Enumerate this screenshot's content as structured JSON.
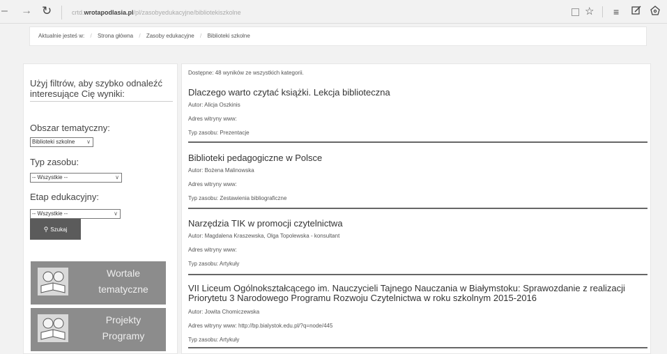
{
  "browser": {
    "back_icon": "arrow-left",
    "forward_icon": "arrow-right",
    "reload_icon": "reload",
    "url_prefix": "crtd.",
    "url_host": "wrotapodlasia.pl",
    "url_path": "/pl/zasobyedukacyjne/bibliotekiszkolne",
    "toolbar_icons": [
      "reading-view",
      "favorite-star",
      "hub",
      "web-note",
      "share"
    ]
  },
  "breadcrumb": {
    "intro": "Aktualnie jesteś w:",
    "separator": "/",
    "items": [
      "Strona główna",
      "Zasoby edukacyjne",
      "Biblioteki szkolne"
    ]
  },
  "sidebar": {
    "heading": "Użyj filtrów, aby szybko odnaleźć interesujące Cię wyniki:",
    "filters": [
      {
        "label": "Obszar tematyczny:",
        "value": "Biblioteki szkolne"
      },
      {
        "label": "Typ zasobu:",
        "value": "-- Wszystkie --"
      },
      {
        "label": "Etap edukacyjny:",
        "value": "-- Wszystkie --"
      }
    ],
    "search_button": "Szukaj",
    "promos": [
      {
        "line1": "Wortale",
        "line2": "tematyczne"
      },
      {
        "line1": "Projekty",
        "line2": "Programy"
      }
    ]
  },
  "results": {
    "summary": "Dostępne: 48 wyników ze wszystkich kategorii.",
    "items": [
      {
        "title": "Dlaczego warto czytać książki. Lekcja biblioteczna",
        "author": "Autor: Alicja Oszkinis",
        "www": "Adres witryny www:",
        "type": "Typ zasobu: Prezentacje"
      },
      {
        "title": "Biblioteki pedagogiczne w Polsce",
        "author": "Autor: Bożena Malinowska",
        "www": "Adres witryny www:",
        "type": "Typ zasobu: Zestawienia bibliograficzne"
      },
      {
        "title": "Narzędzia TIK w promocji czytelnictwa",
        "author": "Autor: Magdalena Kraszewska, Olga Topolewska - konsultant",
        "www": "Adres witryny www:",
        "type": "Typ zasobu: Artykuły"
      },
      {
        "title": "VII Liceum Ogólnokształcącego im. Nauczycieli Tajnego Nauczania w Białymstoku: Sprawozdanie z realizacji Priorytetu 3 Narodowego Programu Rozwoju Czytelnictwa w roku szkolnym 2015-2016",
        "author": "Autor: Jowita Chomiczewska",
        "www": "Adres witryny www: http://bp.bialystok.edu.pl/?q=node/445",
        "type": "Typ zasobu: Artykuły"
      }
    ]
  }
}
